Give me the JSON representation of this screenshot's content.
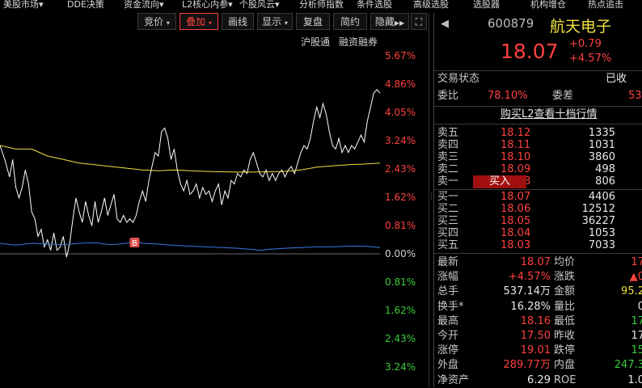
{
  "top_menu": [
    {
      "label": "美股市场",
      "arrow": "▾"
    },
    {
      "label": "DDE决策",
      "arrow": ""
    },
    {
      "label": "资金流向",
      "arrow": "▾"
    },
    {
      "label": "L2核心内参",
      "arrow": "▾"
    },
    {
      "label": "个股风云",
      "arrow": "▾"
    },
    {
      "label": "分析师指数",
      "arrow": ""
    },
    {
      "label": "条件选股",
      "arrow": ""
    },
    {
      "label": "高级选股",
      "arrow": ""
    },
    {
      "label": "选股器",
      "arrow": ""
    },
    {
      "label": "机构增仓",
      "arrow": ""
    },
    {
      "label": "热点追击",
      "arrow": ""
    }
  ],
  "toolbar": {
    "bidding": "竞价",
    "overlay": "叠加",
    "draw": "画线",
    "display": "显示",
    "review": "复盘",
    "simple": "简约",
    "hide": "隐藏",
    "hide_arrows": "▶▶",
    "connect_label": "沪股通",
    "margin_label": "融资融券"
  },
  "colors": {
    "up": "#ff4040",
    "down": "#3ccc3c",
    "price_line": "#ffffff",
    "avg_line": "#f0e040",
    "volume_ratio_line": "#3a78e0"
  },
  "chart_data": {
    "type": "line",
    "y_ticks": [
      {
        "label": "5.67%",
        "pct": 5.67,
        "side": "up"
      },
      {
        "label": "4.86%",
        "pct": 4.86,
        "side": "up"
      },
      {
        "label": "4.05%",
        "pct": 4.05,
        "side": "up"
      },
      {
        "label": "3.24%",
        "pct": 3.24,
        "side": "up"
      },
      {
        "label": "2.43%",
        "pct": 2.43,
        "side": "up"
      },
      {
        "label": "1.62%",
        "pct": 1.62,
        "side": "up"
      },
      {
        "label": "0.81%",
        "pct": 0.81,
        "side": "up"
      },
      {
        "label": "0.00%",
        "pct": 0.0,
        "side": "zero"
      },
      {
        "label": "0.81%",
        "pct": -0.81,
        "side": "down"
      },
      {
        "label": "1.62%",
        "pct": -1.62,
        "side": "down"
      },
      {
        "label": "2.43%",
        "pct": -2.43,
        "side": "down"
      },
      {
        "label": "3.24%",
        "pct": -3.24,
        "side": "down"
      }
    ],
    "y_range_pct": [
      -3.8,
      5.67
    ],
    "x_range_min": [
      0,
      240
    ],
    "series": [
      {
        "key": "price_pct",
        "style": "white",
        "points": [
          [
            0,
            3.1
          ],
          [
            3,
            2.7
          ],
          [
            6,
            2.2
          ],
          [
            8,
            2.7
          ],
          [
            10,
            1.9
          ],
          [
            12,
            1.6
          ],
          [
            14,
            1.9
          ],
          [
            16,
            2.4
          ],
          [
            18,
            2.0
          ],
          [
            20,
            1.2
          ],
          [
            22,
            1.0
          ],
          [
            24,
            0.5
          ],
          [
            26,
            0.7
          ],
          [
            28,
            0.2
          ],
          [
            30,
            0.4
          ],
          [
            32,
            0.1
          ],
          [
            34,
            0.6
          ],
          [
            36,
            0.1
          ],
          [
            38,
            0.2
          ],
          [
            40,
            0.5
          ],
          [
            42,
            -0.1
          ],
          [
            44,
            0.3
          ],
          [
            46,
            1.0
          ],
          [
            48,
            1.6
          ],
          [
            50,
            1.2
          ],
          [
            52,
            0.9
          ],
          [
            54,
            1.5
          ],
          [
            56,
            1.1
          ],
          [
            58,
            0.8
          ],
          [
            60,
            1.5
          ],
          [
            62,
            0.9
          ],
          [
            64,
            1.2
          ],
          [
            66,
            1.6
          ],
          [
            68,
            1.1
          ],
          [
            70,
            1.4
          ],
          [
            72,
            1.7
          ],
          [
            74,
            1.0
          ],
          [
            76,
            0.9
          ],
          [
            78,
            1.1
          ],
          [
            80,
            0.9
          ],
          [
            82,
            1.0
          ],
          [
            84,
            0.9
          ],
          [
            86,
            1.1
          ],
          [
            88,
            1.5
          ],
          [
            90,
            1.8
          ],
          [
            92,
            1.5
          ],
          [
            94,
            2.1
          ],
          [
            96,
            2.5
          ],
          [
            98,
            2.9
          ],
          [
            100,
            2.8
          ],
          [
            102,
            3.5
          ],
          [
            104,
            3.6
          ],
          [
            106,
            3.3
          ],
          [
            108,
            2.7
          ],
          [
            110,
            3.0
          ],
          [
            112,
            2.4
          ],
          [
            114,
            2.0
          ],
          [
            116,
            1.8
          ],
          [
            118,
            2.1
          ],
          [
            120,
            1.7
          ],
          [
            122,
            1.8
          ],
          [
            124,
            2.0
          ],
          [
            126,
            1.6
          ],
          [
            128,
            1.9
          ],
          [
            130,
            1.7
          ],
          [
            132,
            1.8
          ],
          [
            134,
            1.5
          ],
          [
            136,
            1.8
          ],
          [
            138,
            2.0
          ],
          [
            140,
            1.4
          ],
          [
            142,
            1.8
          ],
          [
            144,
            1.6
          ],
          [
            146,
            2.1
          ],
          [
            148,
            2.0
          ],
          [
            150,
            2.3
          ],
          [
            152,
            2.2
          ],
          [
            154,
            2.4
          ],
          [
            156,
            2.3
          ],
          [
            158,
            2.7
          ],
          [
            160,
            2.9
          ],
          [
            162,
            2.6
          ],
          [
            164,
            2.3
          ],
          [
            166,
            2.2
          ],
          [
            168,
            2.4
          ],
          [
            170,
            2.1
          ],
          [
            172,
            2.3
          ],
          [
            174,
            2.1
          ],
          [
            176,
            2.3
          ],
          [
            178,
            2.4
          ],
          [
            180,
            2.2
          ],
          [
            182,
            2.4
          ],
          [
            184,
            2.5
          ],
          [
            186,
            2.3
          ],
          [
            188,
            2.6
          ],
          [
            190,
            2.9
          ],
          [
            192,
            3.1
          ],
          [
            194,
            3.0
          ],
          [
            196,
            3.3
          ],
          [
            198,
            3.8
          ],
          [
            200,
            4.2
          ],
          [
            202,
            3.9
          ],
          [
            204,
            4.3
          ],
          [
            206,
            4.0
          ],
          [
            208,
            3.5
          ],
          [
            210,
            3.1
          ],
          [
            212,
            3.0
          ],
          [
            214,
            3.3
          ],
          [
            216,
            2.9
          ],
          [
            218,
            3.1
          ],
          [
            220,
            2.9
          ],
          [
            222,
            3.1
          ],
          [
            224,
            3.0
          ],
          [
            226,
            3.2
          ],
          [
            228,
            3.4
          ],
          [
            230,
            3.2
          ],
          [
            232,
            3.8
          ],
          [
            234,
            4.2
          ],
          [
            236,
            4.6
          ],
          [
            238,
            4.7
          ],
          [
            240,
            4.6
          ]
        ]
      },
      {
        "key": "avg_pct",
        "style": "yellow",
        "points": [
          [
            0,
            3.1
          ],
          [
            10,
            3.0
          ],
          [
            20,
            3.0
          ],
          [
            30,
            2.8
          ],
          [
            40,
            2.7
          ],
          [
            50,
            2.6
          ],
          [
            60,
            2.55
          ],
          [
            70,
            2.5
          ],
          [
            80,
            2.45
          ],
          [
            90,
            2.4
          ],
          [
            100,
            2.38
          ],
          [
            110,
            2.4
          ],
          [
            120,
            2.38
          ],
          [
            130,
            2.36
          ],
          [
            140,
            2.35
          ],
          [
            150,
            2.34
          ],
          [
            160,
            2.34
          ],
          [
            170,
            2.35
          ],
          [
            180,
            2.36
          ],
          [
            190,
            2.4
          ],
          [
            200,
            2.48
          ],
          [
            210,
            2.52
          ],
          [
            220,
            2.55
          ],
          [
            230,
            2.57
          ],
          [
            240,
            2.6
          ]
        ]
      },
      {
        "key": "volume_ratio_pct",
        "style": "blue",
        "points": [
          [
            0,
            0.3
          ],
          [
            10,
            0.25
          ],
          [
            20,
            0.3
          ],
          [
            30,
            0.28
          ],
          [
            40,
            0.26
          ],
          [
            50,
            0.3
          ],
          [
            60,
            0.32
          ],
          [
            70,
            0.26
          ],
          [
            80,
            0.3
          ],
          [
            85,
            0.36
          ],
          [
            90,
            0.3
          ],
          [
            100,
            0.28
          ],
          [
            110,
            0.24
          ],
          [
            120,
            0.22
          ],
          [
            130,
            0.2
          ],
          [
            140,
            0.18
          ],
          [
            150,
            0.16
          ],
          [
            160,
            0.12
          ],
          [
            165,
            0.1
          ],
          [
            170,
            0.13
          ],
          [
            180,
            0.16
          ],
          [
            190,
            0.18
          ],
          [
            200,
            0.2
          ],
          [
            210,
            0.2
          ],
          [
            220,
            0.22
          ],
          [
            230,
            0.22
          ],
          [
            240,
            0.18
          ]
        ]
      }
    ],
    "marker": {
      "label": "B",
      "x": 85
    }
  },
  "stock": {
    "code": "600879",
    "name": "航天电子",
    "price": "18.07",
    "change": "+0.79",
    "change_pct": "+4.57%",
    "trade_status_label": "交易状态",
    "trade_status_value": "已收",
    "weibi_label": "委比",
    "weibi_value": "78.10%",
    "weicha_label": "委差",
    "weicha_value": "53",
    "l2_link": "购买L2查看十档行情",
    "buy_tag": "买入",
    "sell_orders": [
      {
        "label": "卖五",
        "price": "18.12",
        "vol": "1335"
      },
      {
        "label": "卖四",
        "price": "18.11",
        "vol": "1031"
      },
      {
        "label": "卖三",
        "price": "18.10",
        "vol": "3860"
      },
      {
        "label": "卖二",
        "price": "18.09",
        "vol": "498"
      },
      {
        "label": "卖一",
        "price": "18.08",
        "vol": "806"
      }
    ],
    "buy_orders": [
      {
        "label": "买一",
        "price": "18.07",
        "vol": "4406"
      },
      {
        "label": "买二",
        "price": "18.06",
        "vol": "12512"
      },
      {
        "label": "买三",
        "price": "18.05",
        "vol": "36227"
      },
      {
        "label": "买四",
        "price": "18.04",
        "vol": "1053"
      },
      {
        "label": "买五",
        "price": "18.03",
        "vol": "7033"
      }
    ],
    "stats": [
      {
        "l1": "最新",
        "v1": "18.07",
        "c1": "red",
        "l2": "均价",
        "v2": "17",
        "c2": "red"
      },
      {
        "l1": "涨幅",
        "v1": "+4.57%",
        "c1": "red",
        "l2": "涨跌",
        "v2": "▲0",
        "c2": "red"
      },
      {
        "l1": "总手",
        "v1": "537.14万",
        "c1": "wht",
        "l2": "金额",
        "v2": "95.2",
        "c2": "yel"
      },
      {
        "l1": "换手*",
        "v1": "16.28%",
        "c1": "wht",
        "l2": "量比",
        "v2": "0",
        "c2": "wht"
      },
      {
        "l1": "最高",
        "v1": "18.16",
        "c1": "red",
        "l2": "最低",
        "v2": "17",
        "c2": "grn"
      },
      {
        "l1": "今开",
        "v1": "17.50",
        "c1": "red",
        "l2": "昨收",
        "v2": "17",
        "c2": "wht"
      },
      {
        "l1": "涨停",
        "v1": "19.01",
        "c1": "red",
        "l2": "跌停",
        "v2": "15",
        "c2": "grn"
      },
      {
        "l1": "外盘",
        "v1": "289.77万",
        "c1": "red",
        "l2": "内盘",
        "v2": "247.3",
        "c2": "grn"
      },
      {
        "l1": "净资产",
        "v1": "6.29",
        "c1": "wht",
        "l2": "ROE",
        "v2": "1.0",
        "c2": "wht"
      }
    ]
  }
}
